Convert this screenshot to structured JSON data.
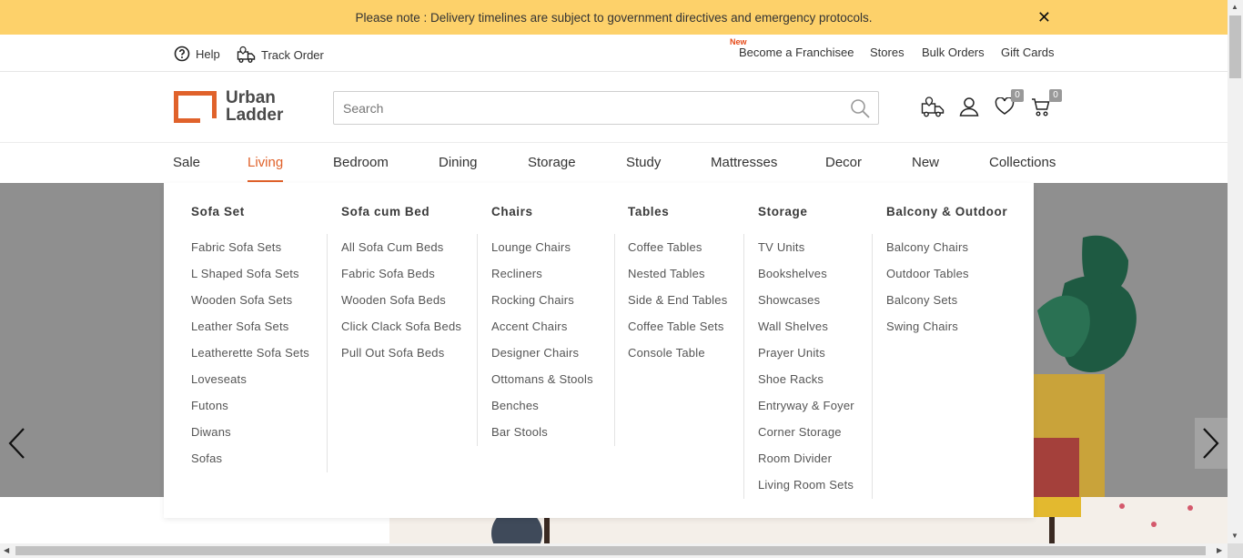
{
  "notice": {
    "text": "Please note : Delivery timelines are subject to government directives and emergency protocols.",
    "close": "✕"
  },
  "utility": {
    "help": "Help",
    "track_order": "Track Order",
    "new_tag": "New",
    "franchisee": "Become a Franchisee",
    "stores": "Stores",
    "bulk_orders": "Bulk Orders",
    "gift_cards": "Gift Cards"
  },
  "brand": {
    "line1": "Urban",
    "line2": "Ladder",
    "accent": "#e0622b"
  },
  "search": {
    "placeholder": "Search",
    "value": ""
  },
  "counts": {
    "wishlist": "0",
    "cart": "0"
  },
  "nav": [
    "Sale",
    "Living",
    "Bedroom",
    "Dining",
    "Storage",
    "Study",
    "Mattresses",
    "Decor",
    "New",
    "Collections"
  ],
  "nav_active": "Living",
  "menu": [
    {
      "title": "Sofa Set",
      "links": [
        "Fabric Sofa Sets",
        "L Shaped Sofa Sets",
        "Wooden Sofa Sets",
        "Leather Sofa Sets",
        "Leatherette Sofa Sets",
        "Loveseats",
        "Futons",
        "Diwans",
        "Sofas"
      ]
    },
    {
      "title": "Sofa cum Bed",
      "links": [
        "All Sofa Cum Beds",
        "Fabric Sofa Beds",
        "Wooden Sofa Beds",
        "Click Clack Sofa Beds",
        "Pull Out Sofa Beds"
      ]
    },
    {
      "title": "Chairs",
      "links": [
        "Lounge Chairs",
        "Recliners",
        "Rocking Chairs",
        "Accent Chairs",
        "Designer Chairs",
        "Ottomans & Stools",
        "Benches",
        "Bar Stools"
      ]
    },
    {
      "title": "Tables",
      "links": [
        "Coffee Tables",
        "Nested Tables",
        "Side & End Tables",
        "Coffee Table Sets",
        "Console Table"
      ]
    },
    {
      "title": "Storage",
      "links": [
        "TV Units",
        "Bookshelves",
        "Showcases",
        "Wall Shelves",
        "Prayer Units",
        "Shoe Racks",
        "Entryway & Foyer",
        "Corner Storage",
        "Room Divider",
        "Living Room Sets"
      ]
    },
    {
      "title": "Balcony & Outdoor",
      "links": [
        "Balcony Chairs",
        "Outdoor Tables",
        "Balcony Sets",
        "Swing Chairs"
      ]
    }
  ],
  "colors": {
    "banner": "#fdd16a",
    "hero": "#8f8f8f"
  }
}
